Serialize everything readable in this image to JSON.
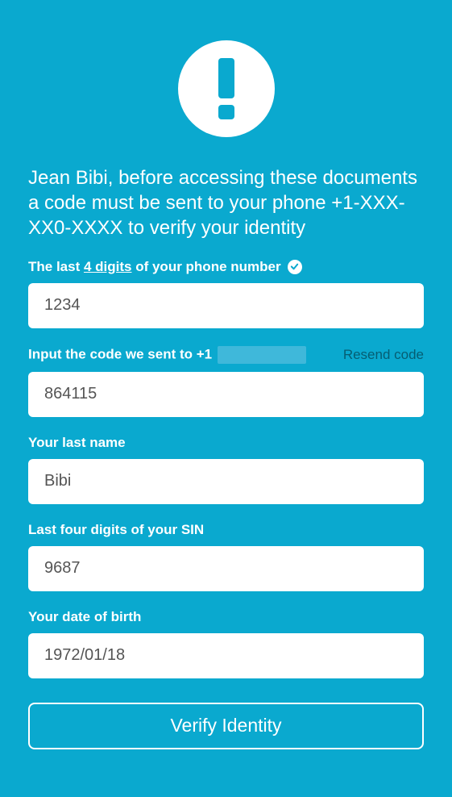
{
  "icons": {
    "alert": "exclamation-icon",
    "check": "check-circle-icon"
  },
  "heading": "Jean Bibi, before accessing these documents a code must be sent to your phone +1-XXX-XX0-XXXX to verify your identity",
  "fields": {
    "phone_digits": {
      "label_prefix": "The last ",
      "label_underlined": "4 digits",
      "label_suffix": " of your phone number",
      "value": "1234"
    },
    "code": {
      "label_prefix": "Input the code we sent to +1",
      "resend_label": "Resend code",
      "value": "864115"
    },
    "last_name": {
      "label": "Your last name",
      "value": "Bibi"
    },
    "sin": {
      "label": "Last four digits of your SIN",
      "value": "9687"
    },
    "dob": {
      "label": "Your date of birth",
      "value": "1972/01/18"
    }
  },
  "submit_label": "Verify Identity"
}
